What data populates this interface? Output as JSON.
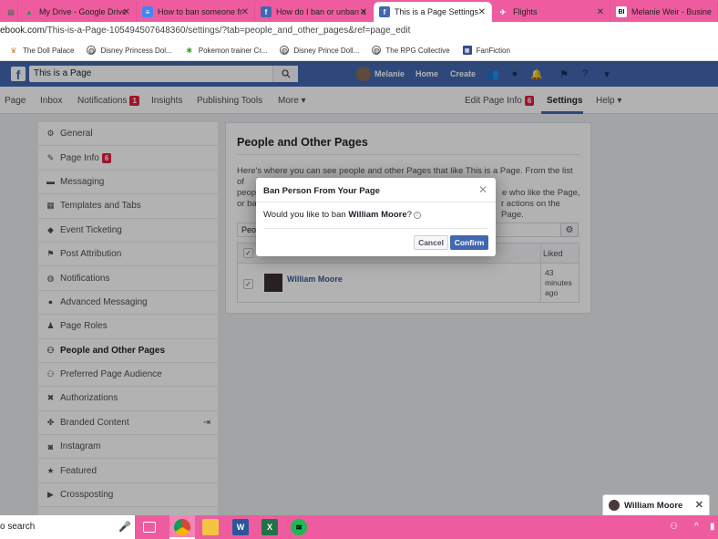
{
  "browser": {
    "tabs": [
      {
        "label": "",
        "icon": "partial-tab-icon",
        "active": false
      },
      {
        "label": "My Drive - Google Drive",
        "icon": "google-drive-icon",
        "active": false
      },
      {
        "label": "How to ban someone fr",
        "icon": "docs-icon",
        "active": false
      },
      {
        "label": "How do I ban or unban a",
        "icon": "facebook-icon",
        "active": false
      },
      {
        "label": "This is a Page Settings",
        "icon": "facebook-icon",
        "active": true
      },
      {
        "label": "Flights",
        "icon": "flights-icon",
        "active": false
      },
      {
        "label": "Melanie Weir - Business",
        "icon": "bi-icon",
        "active": false
      }
    ],
    "address": {
      "host": "ebook.com",
      "path": "/This-is-a-Page-105494507648360/settings/?tab=people_and_other_pages&ref=page_edit"
    },
    "bookmarks": [
      {
        "label": "The Doll Palace",
        "icon": "doll-palace-icon"
      },
      {
        "label": "Disney Princess Dol...",
        "icon": "globe-icon"
      },
      {
        "label": "Pokemon trainer Cr...",
        "icon": "pokemon-icon"
      },
      {
        "label": "Disney Prince Doll...",
        "icon": "globe-icon"
      },
      {
        "label": "The RPG Collective",
        "icon": "globe-icon"
      },
      {
        "label": "FanFiction",
        "icon": "fanfiction-icon"
      }
    ]
  },
  "fb_header": {
    "logo": "f",
    "search_value": "This is a Page",
    "user_name": "Melanie",
    "home_label": "Home",
    "create_label": "Create",
    "brand_color": "#4267b2"
  },
  "page_nav": {
    "items": [
      {
        "label": "Page",
        "badge": ""
      },
      {
        "label": "Inbox",
        "badge": ""
      },
      {
        "label": "Notifications",
        "badge": "1"
      },
      {
        "label": "Insights",
        "badge": ""
      },
      {
        "label": "Publishing Tools",
        "badge": ""
      },
      {
        "label": "More ▾",
        "badge": ""
      }
    ],
    "right": [
      {
        "label": "Edit Page Info",
        "badge": "6"
      },
      {
        "label": "Settings",
        "badge": "",
        "active": true
      },
      {
        "label": "Help ▾",
        "badge": ""
      }
    ]
  },
  "sidebar": {
    "items": [
      {
        "label": "General",
        "icon": "gear-icon",
        "badge": ""
      },
      {
        "label": "Page Info",
        "icon": "pencil-icon",
        "badge": "6"
      },
      {
        "label": "Messaging",
        "icon": "messaging-icon",
        "badge": ""
      },
      {
        "label": "Templates and Tabs",
        "icon": "grid-icon",
        "badge": ""
      },
      {
        "label": "Event Ticketing",
        "icon": "ticket-icon",
        "badge": ""
      },
      {
        "label": "Post Attribution",
        "icon": "flag-icon",
        "badge": ""
      },
      {
        "label": "Notifications",
        "icon": "globe-icon",
        "badge": ""
      },
      {
        "label": "Advanced Messaging",
        "icon": "chat-icon",
        "badge": ""
      },
      {
        "label": "Page Roles",
        "icon": "person-icon",
        "badge": ""
      },
      {
        "label": "People and Other Pages",
        "icon": "people-icon",
        "badge": "",
        "active": true
      },
      {
        "label": "Preferred Page Audience",
        "icon": "people-icon",
        "badge": ""
      },
      {
        "label": "Authorizations",
        "icon": "wrench-icon",
        "badge": ""
      },
      {
        "label": "Branded Content",
        "icon": "handshake-icon",
        "badge": ""
      },
      {
        "label": "Instagram",
        "icon": "instagram-icon",
        "badge": ""
      },
      {
        "label": "Featured",
        "icon": "star-icon",
        "badge": ""
      },
      {
        "label": "Crossposting",
        "icon": "video-icon",
        "badge": ""
      }
    ]
  },
  "main": {
    "title": "People and Other Pages",
    "description": "Here's where you can see people and other Pages that like This is a Page. From the list of people who like the Page, you can remove people who like the Page, or ban them from taking actions on the Page.",
    "desc_left_lines": [
      "Here's where you can see people and other Pages that like This is a Page. From the list of",
      "peop",
      "or ba"
    ],
    "desc_right_lines": [
      "e who like the Page,",
      "r actions on the Page."
    ],
    "filter_label": "Peo",
    "table": {
      "liked_header": "Liked",
      "rows": [
        {
          "name": "William Moore",
          "liked": "43 minutes ago"
        }
      ]
    }
  },
  "modal": {
    "title": "Ban Person From Your Page",
    "body_prefix": "Would you like to ban ",
    "body_name": "William Moore",
    "body_suffix": "?",
    "cancel_label": "Cancel",
    "confirm_label": "Confirm"
  },
  "chat": {
    "name": "William Moore"
  },
  "taskbar": {
    "search_text": "o search",
    "apps": [
      "task-view-icon",
      "chrome-icon",
      "file-explorer-icon",
      "word-icon",
      "excel-icon",
      "spotify-icon"
    ]
  }
}
